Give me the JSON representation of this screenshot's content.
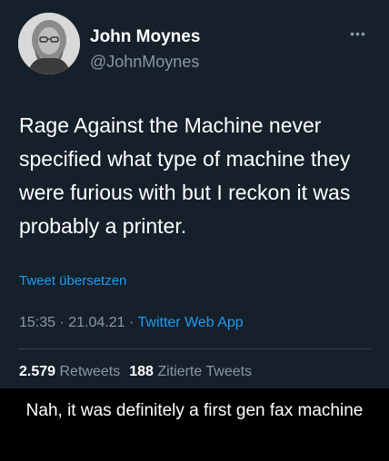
{
  "tweet": {
    "display_name": "John Moynes",
    "handle": "@JohnMoynes",
    "more_icon": "more-horizontal-icon",
    "text": "Rage Against the Machine never specified what type of machine they were furious with but I reckon it was probably a printer.",
    "translate_label": "Tweet übersetzen",
    "time": "15:35",
    "date": "21.04.21",
    "separator": "·",
    "app": "Twitter Web App",
    "retweets_count": "2.579",
    "retweets_label": "Retweets",
    "quotes_count": "188",
    "quotes_label": "Zitierte Tweets"
  },
  "caption": "Nah, it was definitely a first gen fax machine",
  "colors": {
    "background": "#15202b",
    "page": "#000000",
    "link": "#1d9bf0",
    "secondary_text": "#8b98a5",
    "divider": "#38444d"
  }
}
